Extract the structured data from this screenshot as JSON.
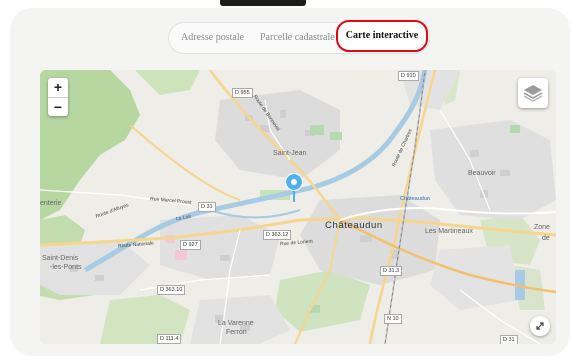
{
  "tabs": [
    {
      "label": "Adresse postale"
    },
    {
      "label": "Parcelle cadastrale"
    },
    {
      "label": "Carte interactive",
      "active": true
    }
  ],
  "accent_color": "#e30613",
  "map": {
    "zoom_in": "+",
    "zoom_out": "−",
    "labels": {
      "city": "Châteaudun",
      "saint_jean": "Saint-Jean",
      "beauvoir": "Beauvoir",
      "les_martineaux": "Les Martineaux",
      "zone": "Zone",
      "zone_de": "de",
      "saint_denis_1": "Saint-Denis",
      "saint_denis_2": "-les-Ponts",
      "la_varenne_1": "La Varenne",
      "la_varenne_2": "Ferron",
      "chateaudun_station": "Châteaudun",
      "left_edge": "enterie"
    },
    "roads": {
      "d955": "D 955",
      "d910": "D 910",
      "d31_a": "D 31",
      "d927": "D 927",
      "d36312": "D 363.12",
      "d3631": "D 31.3",
      "d36310": "D 363.10",
      "d1114": "D 111.4",
      "n10": "N 10",
      "d31_b": "D 31"
    },
    "streets": {
      "route_alluyes": "Route d'Alluyes",
      "rue_marcel_proust": "Rue Marcel Proust",
      "route_nationale": "Route Nationale",
      "rue_de_marcel": "Le Loir",
      "route_de_bonneval": "Route de Bonneval",
      "rue_de_chartres": "Route de Chartres",
      "rue_de_lorient": "Rue de Lorient"
    },
    "icons": {
      "marker": "map-pin-icon",
      "layers": "layers-icon",
      "fullscreen": "expand-icon"
    }
  }
}
